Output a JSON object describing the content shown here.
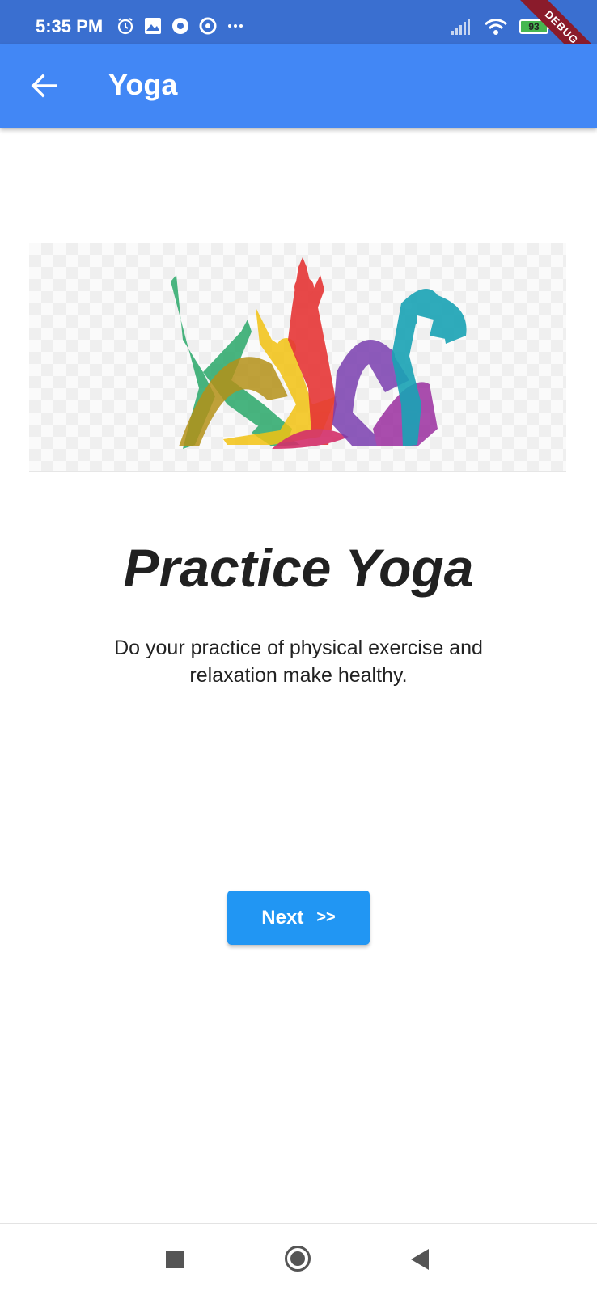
{
  "status_bar": {
    "time": "5:35 PM",
    "icons": [
      "alarm-icon",
      "photos-icon",
      "chrome-icon",
      "vpn-icon",
      "more-icon"
    ],
    "right_icons": [
      "signal-icon",
      "wifi-icon",
      "battery-icon"
    ],
    "battery_level": "93",
    "debug_banner": "DEBUG"
  },
  "app_bar": {
    "title": "Yoga",
    "back_icon": "arrow-back-icon",
    "color": "#4287f5"
  },
  "content": {
    "illustration": "yoga-silhouettes-image",
    "headline": "Practice Yoga",
    "description": "Do your practice of physical exercise and relaxation make healthy."
  },
  "actions": {
    "next_label": "Next",
    "next_arrows": ">>",
    "button_color": "#2196f3"
  },
  "nav_bar": {
    "icons": [
      "recents-icon",
      "home-icon",
      "back-icon"
    ]
  }
}
